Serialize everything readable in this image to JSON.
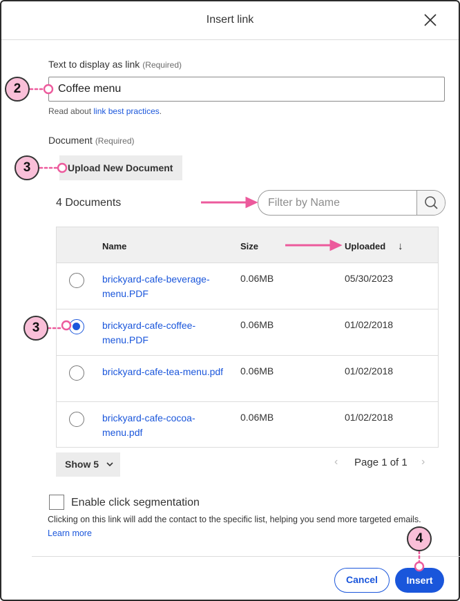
{
  "dialog": {
    "title": "Insert link"
  },
  "link_text": {
    "label": "Text to display as link",
    "required": "(Required)",
    "value": "Coffee menu",
    "help_prefix": "Read about ",
    "help_link": "link best practices",
    "help_suffix": "."
  },
  "document": {
    "label": "Document",
    "required": "(Required)",
    "upload_button": "Upload New Document",
    "count": "4 Documents",
    "filter_placeholder": "Filter by Name"
  },
  "table": {
    "columns": {
      "name": "Name",
      "size": "Size",
      "uploaded": "Uploaded"
    },
    "sort_indicator": "↓",
    "rows": [
      {
        "name": "brickyard-cafe-beverage-menu.PDF",
        "size": "0.06MB",
        "uploaded": "05/30/2023",
        "selected": false
      },
      {
        "name": "brickyard-cafe-coffee-menu.PDF",
        "size": "0.06MB",
        "uploaded": "01/02/2018",
        "selected": true
      },
      {
        "name": "brickyard-cafe-tea-menu.pdf",
        "size": "0.06MB",
        "uploaded": "01/02/2018",
        "selected": false
      },
      {
        "name": "brickyard-cafe-cocoa-menu.pdf",
        "size": "0.06MB",
        "uploaded": "01/02/2018",
        "selected": false
      }
    ]
  },
  "pagination": {
    "show_label": "Show 5",
    "page_text": "Page 1 of 1",
    "prev": "‹",
    "next": "›"
  },
  "segmentation": {
    "checkbox_label": "Enable click segmentation",
    "checked": false,
    "description": "Clicking on this link will add the contact to the specific list, helping you send more targeted emails.",
    "learn_more": "Learn more"
  },
  "footer": {
    "cancel": "Cancel",
    "insert": "Insert"
  },
  "callouts": [
    "2",
    "3",
    "3",
    "4"
  ],
  "colors": {
    "accent": "#1a56db",
    "callout_fill": "#f9bfd8",
    "arrow": "#ec5a9c"
  },
  "icons": {
    "close": "close-icon",
    "search": "search-icon",
    "sort": "arrow-down-icon",
    "dropdown": "chevron-down-icon"
  }
}
